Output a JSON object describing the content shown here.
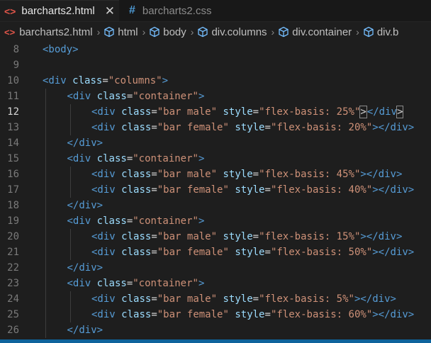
{
  "tabs": [
    {
      "icon": "<>",
      "label": "barcharts2.html",
      "close": "✕"
    },
    {
      "icon": "#",
      "label": "barcharts2.css"
    }
  ],
  "breadcrumb": [
    "barcharts2.html",
    "html",
    "body",
    "div.columns",
    "div.container",
    "div.b"
  ],
  "colors": {
    "tag": "#569cd6",
    "attribute": "#9cdcfe",
    "string": "#ce9178",
    "punctuation": "#d4d4d4",
    "html_icon": "#e2564a",
    "css_icon": "#4e9bd6",
    "statusbar": "#0e639c"
  },
  "editor": {
    "current_line": "12",
    "lines": [
      {
        "n": "8",
        "indent": 0,
        "tokens": [
          [
            "t",
            "<body>"
          ]
        ]
      },
      {
        "n": "9",
        "indent": 0,
        "tokens": []
      },
      {
        "n": "10",
        "indent": 0,
        "tokens": [
          [
            "t",
            "<div "
          ],
          [
            "a",
            "class"
          ],
          [
            "p",
            "="
          ],
          [
            "s",
            "\"columns\""
          ],
          [
            "t",
            ">"
          ]
        ]
      },
      {
        "n": "11",
        "indent": 1,
        "tokens": [
          [
            "t",
            "<div "
          ],
          [
            "a",
            "class"
          ],
          [
            "p",
            "="
          ],
          [
            "s",
            "\"container\""
          ],
          [
            "t",
            ">"
          ]
        ]
      },
      {
        "n": "12",
        "indent": 2,
        "tokens": [
          [
            "t",
            "<div "
          ],
          [
            "a",
            "class"
          ],
          [
            "p",
            "="
          ],
          [
            "s",
            "\"bar male\""
          ],
          [
            "t",
            " "
          ],
          [
            "a",
            "style"
          ],
          [
            "p",
            "="
          ],
          [
            "s",
            "\"flex-basis: 25%\""
          ],
          [
            "m",
            ">"
          ],
          [
            "cursor",
            ""
          ],
          [
            "t",
            "</div"
          ],
          [
            "m",
            ">"
          ]
        ]
      },
      {
        "n": "13",
        "indent": 2,
        "tokens": [
          [
            "t",
            "<div "
          ],
          [
            "a",
            "class"
          ],
          [
            "p",
            "="
          ],
          [
            "s",
            "\"bar female\""
          ],
          [
            "t",
            " "
          ],
          [
            "a",
            "style"
          ],
          [
            "p",
            "="
          ],
          [
            "s",
            "\"flex-basis: 20%\""
          ],
          [
            "t",
            "></div>"
          ]
        ]
      },
      {
        "n": "14",
        "indent": 1,
        "tokens": [
          [
            "t",
            "</div>"
          ]
        ]
      },
      {
        "n": "15",
        "indent": 1,
        "tokens": [
          [
            "t",
            "<div "
          ],
          [
            "a",
            "class"
          ],
          [
            "p",
            "="
          ],
          [
            "s",
            "\"container\""
          ],
          [
            "t",
            ">"
          ]
        ]
      },
      {
        "n": "16",
        "indent": 2,
        "tokens": [
          [
            "t",
            "<div "
          ],
          [
            "a",
            "class"
          ],
          [
            "p",
            "="
          ],
          [
            "s",
            "\"bar male\""
          ],
          [
            "t",
            " "
          ],
          [
            "a",
            "style"
          ],
          [
            "p",
            "="
          ],
          [
            "s",
            "\"flex-basis: 45%\""
          ],
          [
            "t",
            "></div>"
          ]
        ]
      },
      {
        "n": "17",
        "indent": 2,
        "tokens": [
          [
            "t",
            "<div "
          ],
          [
            "a",
            "class"
          ],
          [
            "p",
            "="
          ],
          [
            "s",
            "\"bar female\""
          ],
          [
            "t",
            " "
          ],
          [
            "a",
            "style"
          ],
          [
            "p",
            "="
          ],
          [
            "s",
            "\"flex-basis: 40%\""
          ],
          [
            "t",
            "></div>"
          ]
        ]
      },
      {
        "n": "18",
        "indent": 1,
        "tokens": [
          [
            "t",
            "</div>"
          ]
        ]
      },
      {
        "n": "19",
        "indent": 1,
        "tokens": [
          [
            "t",
            "<div "
          ],
          [
            "a",
            "class"
          ],
          [
            "p",
            "="
          ],
          [
            "s",
            "\"container\""
          ],
          [
            "t",
            ">"
          ]
        ]
      },
      {
        "n": "20",
        "indent": 2,
        "tokens": [
          [
            "t",
            "<div "
          ],
          [
            "a",
            "class"
          ],
          [
            "p",
            "="
          ],
          [
            "s",
            "\"bar male\""
          ],
          [
            "t",
            " "
          ],
          [
            "a",
            "style"
          ],
          [
            "p",
            "="
          ],
          [
            "s",
            "\"flex-basis: 15%\""
          ],
          [
            "t",
            "></div>"
          ]
        ]
      },
      {
        "n": "21",
        "indent": 2,
        "tokens": [
          [
            "t",
            "<div "
          ],
          [
            "a",
            "class"
          ],
          [
            "p",
            "="
          ],
          [
            "s",
            "\"bar female\""
          ],
          [
            "t",
            " "
          ],
          [
            "a",
            "style"
          ],
          [
            "p",
            "="
          ],
          [
            "s",
            "\"flex-basis: 50%\""
          ],
          [
            "t",
            "></div>"
          ]
        ]
      },
      {
        "n": "22",
        "indent": 1,
        "tokens": [
          [
            "t",
            "</div>"
          ]
        ]
      },
      {
        "n": "23",
        "indent": 1,
        "tokens": [
          [
            "t",
            "<div "
          ],
          [
            "a",
            "class"
          ],
          [
            "p",
            "="
          ],
          [
            "s",
            "\"container\""
          ],
          [
            "t",
            ">"
          ]
        ]
      },
      {
        "n": "24",
        "indent": 2,
        "tokens": [
          [
            "t",
            "<div "
          ],
          [
            "a",
            "class"
          ],
          [
            "p",
            "="
          ],
          [
            "s",
            "\"bar male\""
          ],
          [
            "t",
            " "
          ],
          [
            "a",
            "style"
          ],
          [
            "p",
            "="
          ],
          [
            "s",
            "\"flex-basis: 5%\""
          ],
          [
            "t",
            "></div>"
          ]
        ]
      },
      {
        "n": "25",
        "indent": 2,
        "tokens": [
          [
            "t",
            "<div "
          ],
          [
            "a",
            "class"
          ],
          [
            "p",
            "="
          ],
          [
            "s",
            "\"bar female\""
          ],
          [
            "t",
            " "
          ],
          [
            "a",
            "style"
          ],
          [
            "p",
            "="
          ],
          [
            "s",
            "\"flex-basis: 60%\""
          ],
          [
            "t",
            "></div>"
          ]
        ]
      },
      {
        "n": "26",
        "indent": 1,
        "tokens": [
          [
            "t",
            "</div>"
          ]
        ]
      }
    ]
  }
}
